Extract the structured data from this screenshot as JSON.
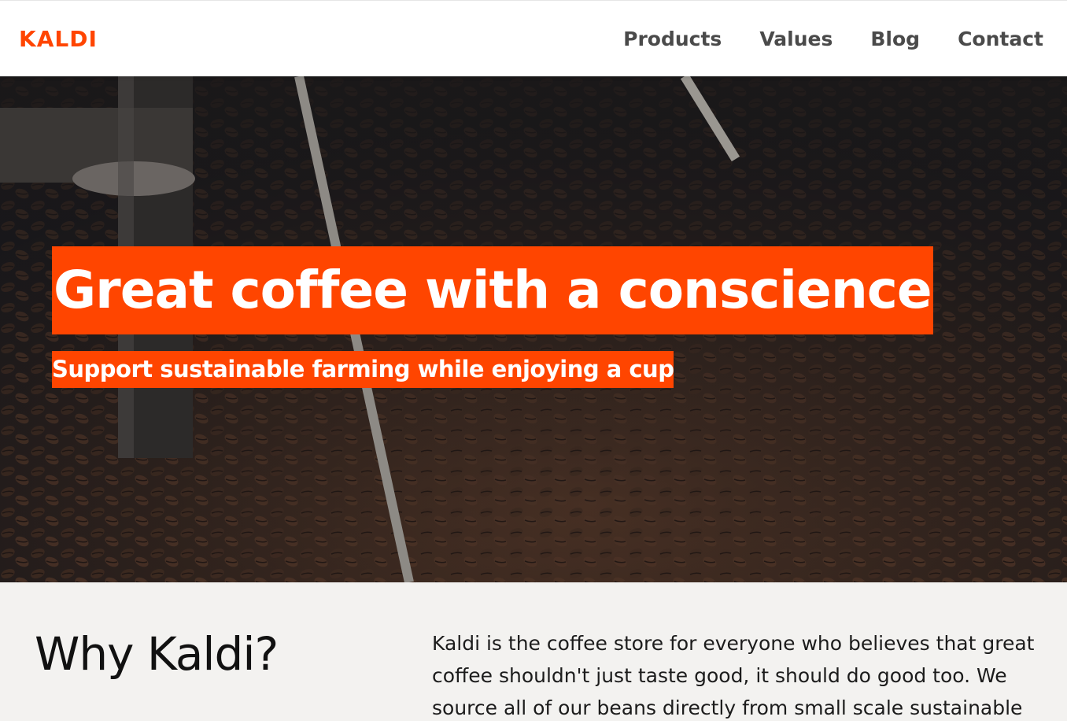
{
  "header": {
    "logo": "KALDI",
    "nav": [
      {
        "label": "Products"
      },
      {
        "label": "Values"
      },
      {
        "label": "Blog"
      },
      {
        "label": "Contact"
      }
    ]
  },
  "hero": {
    "title": "Great coffee with a conscience",
    "subtitle": "Support sustainable farming while enjoying a cup"
  },
  "why": {
    "title": "Why Kaldi?",
    "text": "Kaldi is the coffee store for everyone who believes that great coffee shouldn't just taste good, it should do good too. We source all of our beans directly from small scale sustainable"
  },
  "colors": {
    "accent": "#ff4500",
    "nav_text": "#4a4a4a",
    "section_bg": "#f3f2f0"
  }
}
